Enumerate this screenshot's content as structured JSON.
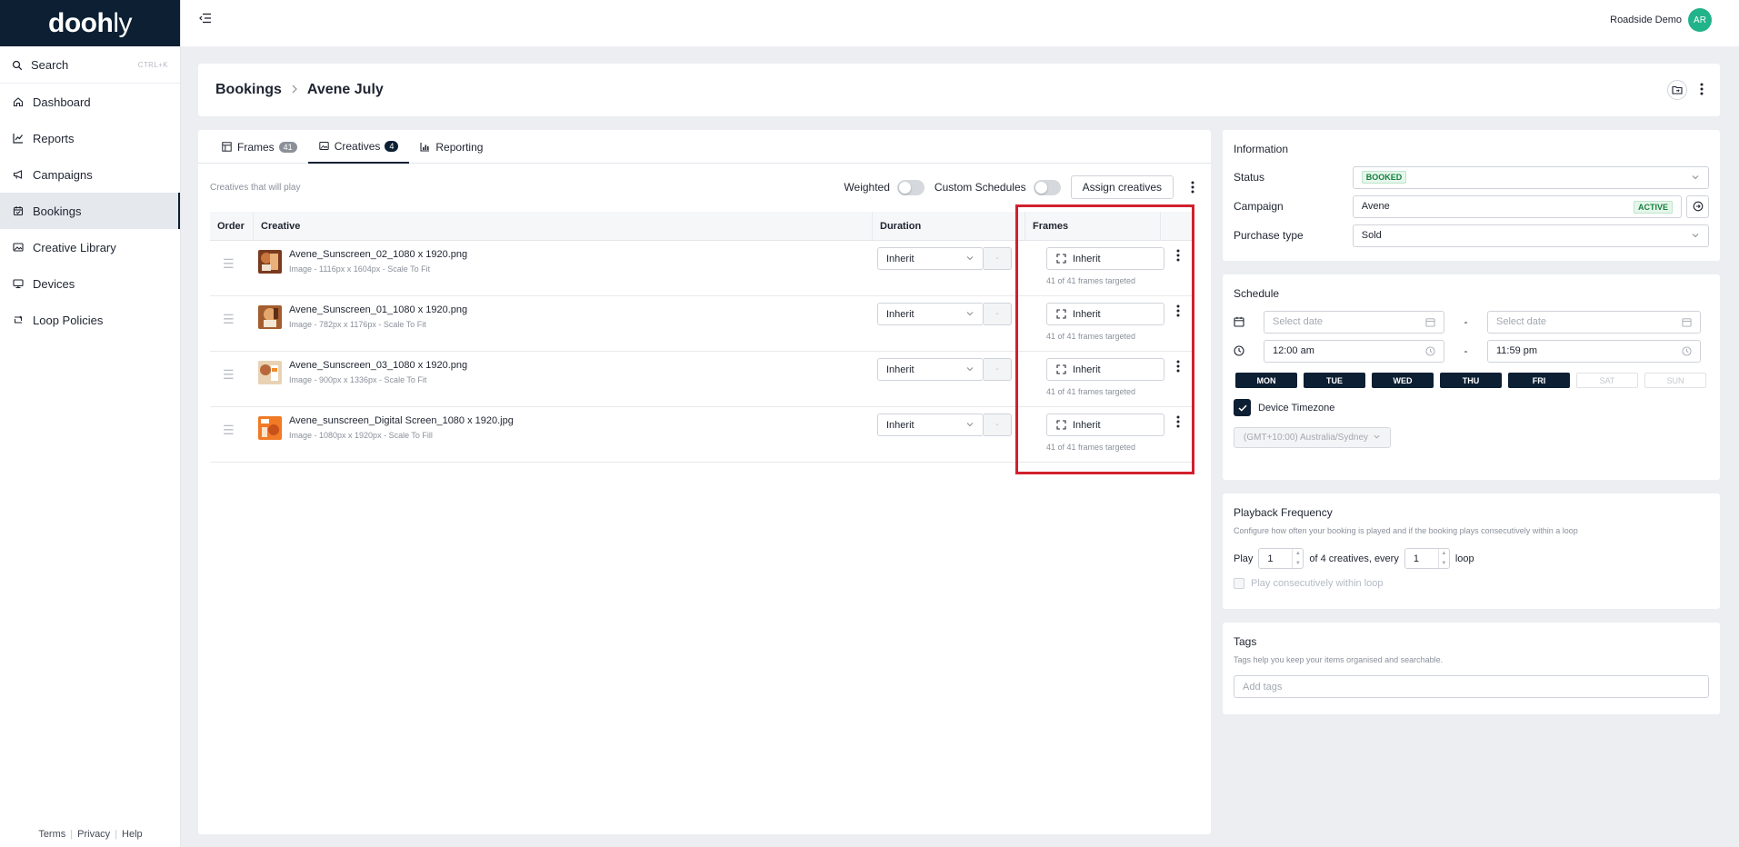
{
  "app": {
    "logo_bold": "dooh",
    "logo_rest": "ly"
  },
  "sidebar": {
    "search_label": "Search",
    "search_shortcut": "CTRL+K",
    "items": [
      {
        "label": "Dashboard",
        "icon": "home-icon"
      },
      {
        "label": "Reports",
        "icon": "chart-icon"
      },
      {
        "label": "Campaigns",
        "icon": "megaphone-icon"
      },
      {
        "label": "Bookings",
        "icon": "calendar-icon",
        "active": true
      },
      {
        "label": "Creative Library",
        "icon": "image-icon"
      },
      {
        "label": "Devices",
        "icon": "monitor-icon"
      },
      {
        "label": "Loop Policies",
        "icon": "loop-icon"
      }
    ],
    "footer": {
      "terms": "Terms",
      "privacy": "Privacy",
      "help": "Help"
    }
  },
  "topbar": {
    "user_name": "Roadside Demo",
    "user_initials": "AR"
  },
  "header": {
    "crumb_parent": "Bookings",
    "crumb_current": "Avene July"
  },
  "tabs": [
    {
      "label": "Frames",
      "count": "41",
      "icon": "table-icon"
    },
    {
      "label": "Creatives",
      "count": "4",
      "icon": "image-icon",
      "active": true
    },
    {
      "label": "Reporting",
      "icon": "chart-icon"
    }
  ],
  "toolbar": {
    "description": "Creatives that will play",
    "weighted_label": "Weighted",
    "custom_schedules_label": "Custom Schedules",
    "assign_label": "Assign creatives"
  },
  "table": {
    "columns": {
      "order": "Order",
      "creative": "Creative",
      "duration": "Duration",
      "frames": "Frames"
    },
    "rows": [
      {
        "name": "Avene_Sunscreen_02_1080 x 1920.png",
        "meta": "Image - 1116px x 1604px - Scale To Fit",
        "duration": "Inherit",
        "duration_value": "-",
        "frames": "Inherit",
        "frames_sub": "41 of 41 frames targeted",
        "thumb_color": "#b8612f"
      },
      {
        "name": "Avene_Sunscreen_01_1080 x 1920.png",
        "meta": "Image - 782px x 1176px - Scale To Fit",
        "duration": "Inherit",
        "duration_value": "-",
        "frames": "Inherit",
        "frames_sub": "41 of 41 frames targeted",
        "thumb_color": "#c8874a"
      },
      {
        "name": "Avene_Sunscreen_03_1080 x 1920.png",
        "meta": "Image - 900px x 1336px - Scale To Fit",
        "duration": "Inherit",
        "duration_value": "-",
        "frames": "Inherit",
        "frames_sub": "41 of 41 frames targeted",
        "thumb_color": "#d8a06a"
      },
      {
        "name": "Avene_sunscreen_Digital Screen_1080 x 1920.jpg",
        "meta": "Image - 1080px x 1920px - Scale To Fill",
        "duration": "Inherit",
        "duration_value": "-",
        "frames": "Inherit",
        "frames_sub": "41 of 41 frames targeted",
        "thumb_color": "#ee6a1f"
      }
    ]
  },
  "info": {
    "title": "Information",
    "status_label": "Status",
    "status_value": "BOOKED",
    "campaign_label": "Campaign",
    "campaign_value": "Avene",
    "campaign_badge": "ACTIVE",
    "purchase_label": "Purchase type",
    "purchase_value": "Sold"
  },
  "schedule": {
    "title": "Schedule",
    "start_date_placeholder": "Select date",
    "end_date_placeholder": "Select date",
    "start_time": "12:00 am",
    "end_time": "11:59 pm",
    "dash": "-",
    "days": [
      {
        "label": "MON",
        "on": true
      },
      {
        "label": "TUE",
        "on": true
      },
      {
        "label": "WED",
        "on": true
      },
      {
        "label": "THU",
        "on": true
      },
      {
        "label": "FRI",
        "on": true
      },
      {
        "label": "SAT",
        "on": false
      },
      {
        "label": "SUN",
        "on": false
      }
    ],
    "device_tz_label": "Device Timezone",
    "timezone": "(GMT+10:00) Australia/Sydney"
  },
  "playback": {
    "title": "Playback Frequency",
    "description": "Configure how often your booking is played and if the booking plays consecutively within a loop",
    "play_label": "Play",
    "play_value": "1",
    "middle_text": "of 4 creatives, every",
    "every_value": "1",
    "loop_label": "loop",
    "consecutive_label": "Play consecutively within loop"
  },
  "tags": {
    "title": "Tags",
    "description": "Tags help you keep your items organised and searchable.",
    "placeholder": "Add tags"
  },
  "colors": {
    "brand": "#0c1f33",
    "avatar": "#22b38a",
    "highlight": "#d1202e"
  }
}
